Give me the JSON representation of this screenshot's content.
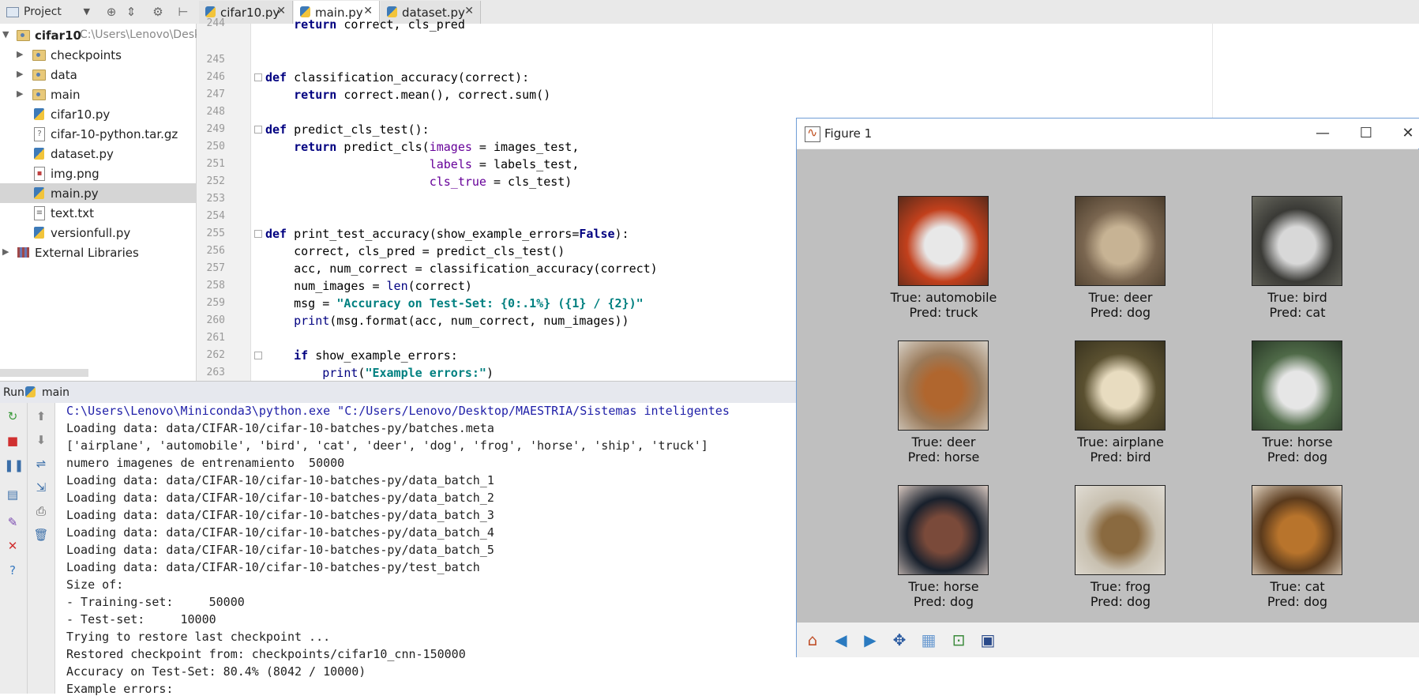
{
  "toolbar": {
    "project_label": "Project",
    "tabs": [
      {
        "label": "cifar10.py",
        "active": false
      },
      {
        "label": "main.py",
        "active": true
      },
      {
        "label": "dataset.py",
        "active": false
      }
    ]
  },
  "project_tree": {
    "root": {
      "name": "cifar10",
      "path": "C:\\Users\\Lenovo\\Desk"
    },
    "items": [
      {
        "label": "checkpoints",
        "type": "folder"
      },
      {
        "label": "data",
        "type": "folder"
      },
      {
        "label": "main",
        "type": "folder"
      },
      {
        "label": "cifar10.py",
        "type": "py"
      },
      {
        "label": "cifar-10-python.tar.gz",
        "type": "archive"
      },
      {
        "label": "dataset.py",
        "type": "py"
      },
      {
        "label": "img.png",
        "type": "image"
      },
      {
        "label": "main.py",
        "type": "py",
        "selected": true
      },
      {
        "label": "text.txt",
        "type": "text"
      },
      {
        "label": "versionfull.py",
        "type": "py"
      }
    ],
    "external": "External Libraries"
  },
  "editor": {
    "line_numbers": [
      "244",
      "245",
      "246",
      "247",
      "248",
      "249",
      "250",
      "251",
      "252",
      "253",
      "254",
      "255",
      "256",
      "257",
      "258",
      "259",
      "260",
      "261",
      "262",
      "263"
    ],
    "lines": [
      "    return correct, cls_pred",
      "",
      "def classification_accuracy(correct):",
      "    return correct.mean(), correct.sum()",
      "",
      "def predict_cls_test():",
      "    return predict_cls(images = images_test,",
      "                       labels = labels_test,",
      "                       cls_true = cls_test)",
      "",
      "",
      "def print_test_accuracy(show_example_errors=False):",
      "    correct, cls_pred = predict_cls_test()",
      "    acc, num_correct = classification_accuracy(correct)",
      "    num_images = len(correct)",
      "    msg = \"Accuracy on Test-Set: {0:.1%} ({1} / {2})\"",
      "    print(msg.format(acc, num_correct, num_images))",
      "",
      "    if show_example_errors:",
      "        print(\"Example errors:\")"
    ]
  },
  "run": {
    "label": "Run",
    "config": "main",
    "console": [
      "C:\\Users\\Lenovo\\Miniconda3\\python.exe \"C:/Users/Lenovo/Desktop/MAESTRIA/Sistemas inteligentes",
      "Loading data: data/CIFAR-10/cifar-10-batches-py/batches.meta",
      "['airplane', 'automobile', 'bird', 'cat', 'deer', 'dog', 'frog', 'horse', 'ship', 'truck']",
      "numero imagenes de entrenamiento  50000",
      "Loading data: data/CIFAR-10/cifar-10-batches-py/data_batch_1",
      "Loading data: data/CIFAR-10/cifar-10-batches-py/data_batch_2",
      "Loading data: data/CIFAR-10/cifar-10-batches-py/data_batch_3",
      "Loading data: data/CIFAR-10/cifar-10-batches-py/data_batch_4",
      "Loading data: data/CIFAR-10/cifar-10-batches-py/data_batch_5",
      "Loading data: data/CIFAR-10/cifar-10-batches-py/test_batch",
      "Size of:",
      "- Training-set:     50000",
      "- Test-set:     10000",
      "Trying to restore last checkpoint ...",
      "Restored checkpoint from: checkpoints/cifar10_cnn-150000",
      "Accuracy on Test-Set: 80.4% (8042 / 10000)",
      "Example errors:"
    ]
  },
  "figure": {
    "title": "Figure 1",
    "images": [
      {
        "true": "True: automobile",
        "pred": "Pred: truck",
        "colors": [
          "#c2401c",
          "#e8e8e8",
          "#5a2a1a"
        ]
      },
      {
        "true": "True: deer",
        "pred": "Pred: dog",
        "colors": [
          "#7a6650",
          "#c7b394",
          "#4a3c2c"
        ]
      },
      {
        "true": "True: bird",
        "pred": "Pred: cat",
        "colors": [
          "#3a3a36",
          "#d8d8d8",
          "#6a6a60"
        ]
      },
      {
        "true": "True: deer",
        "pred": "Pred: horse",
        "colors": [
          "#9a7a5a",
          "#b0662e",
          "#d6d0c6"
        ]
      },
      {
        "true": "True: airplane",
        "pred": "Pred: bird",
        "colors": [
          "#5a5030",
          "#e8dcc0",
          "#3a3420"
        ]
      },
      {
        "true": "True: horse",
        "pred": "Pred: dog",
        "colors": [
          "#4f6a48",
          "#e6e6e6",
          "#2a3a28"
        ]
      },
      {
        "true": "True: horse",
        "pred": "Pred: dog",
        "colors": [
          "#18202c",
          "#7a4a3a",
          "#d8c8c0"
        ]
      },
      {
        "true": "True: frog",
        "pred": "Pred: dog",
        "colors": [
          "#c8c0b0",
          "#8a6a40",
          "#e0dcd4"
        ]
      },
      {
        "true": "True: cat",
        "pred": "Pred: dog",
        "colors": [
          "#5a3a1c",
          "#b8742c",
          "#e0d2c0"
        ]
      }
    ],
    "toolbar_icons": [
      "home-icon",
      "back-icon",
      "forward-icon",
      "pan-icon",
      "subplots-icon",
      "configure-icon",
      "save-icon"
    ]
  }
}
